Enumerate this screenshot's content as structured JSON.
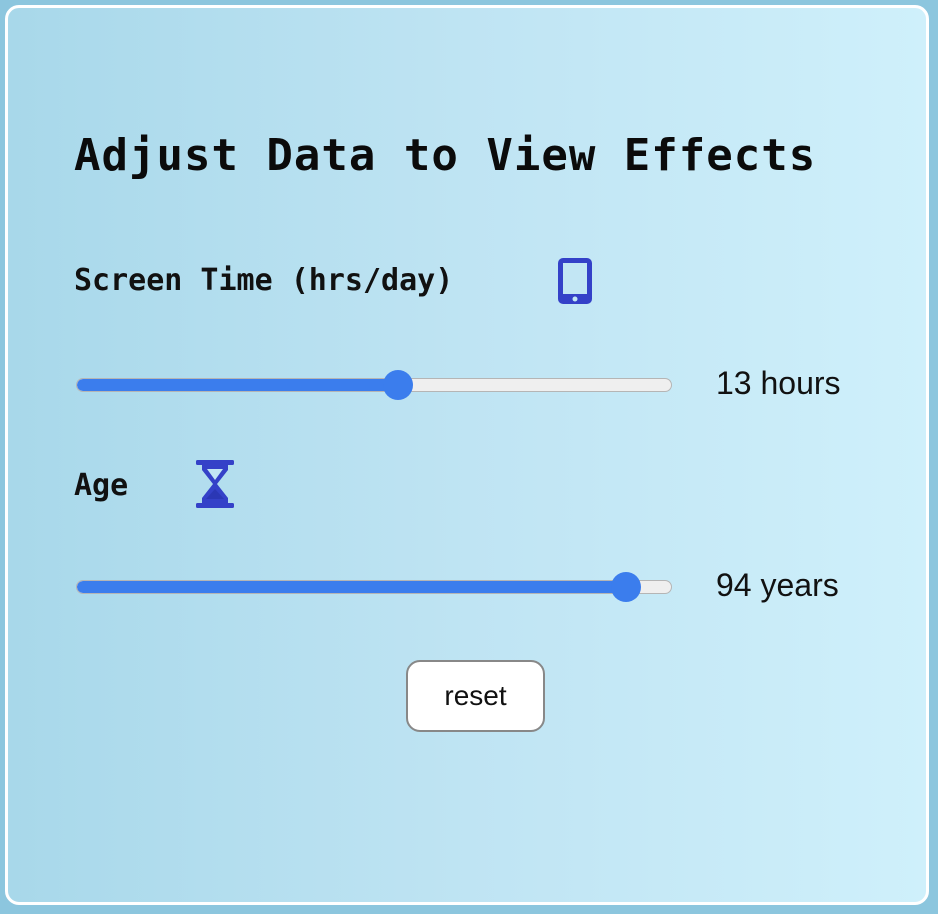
{
  "title": "Adjust Data to View Effects",
  "screen_time": {
    "label": "Screen Time (hrs/day)",
    "icon": "phone-icon",
    "icon_color": "#3441c8",
    "value_text": "13 hours",
    "value": 13,
    "fraction": 0.54
  },
  "age": {
    "label": "Age",
    "icon": "hourglass-icon",
    "icon_color": "#3441c8",
    "value_text": "94 years",
    "value": 94,
    "fraction": 0.92
  },
  "reset_label": "reset",
  "colors": {
    "accent": "#3b7ded",
    "background_start": "#a8d8ea",
    "background_end": "#cff0fb"
  }
}
